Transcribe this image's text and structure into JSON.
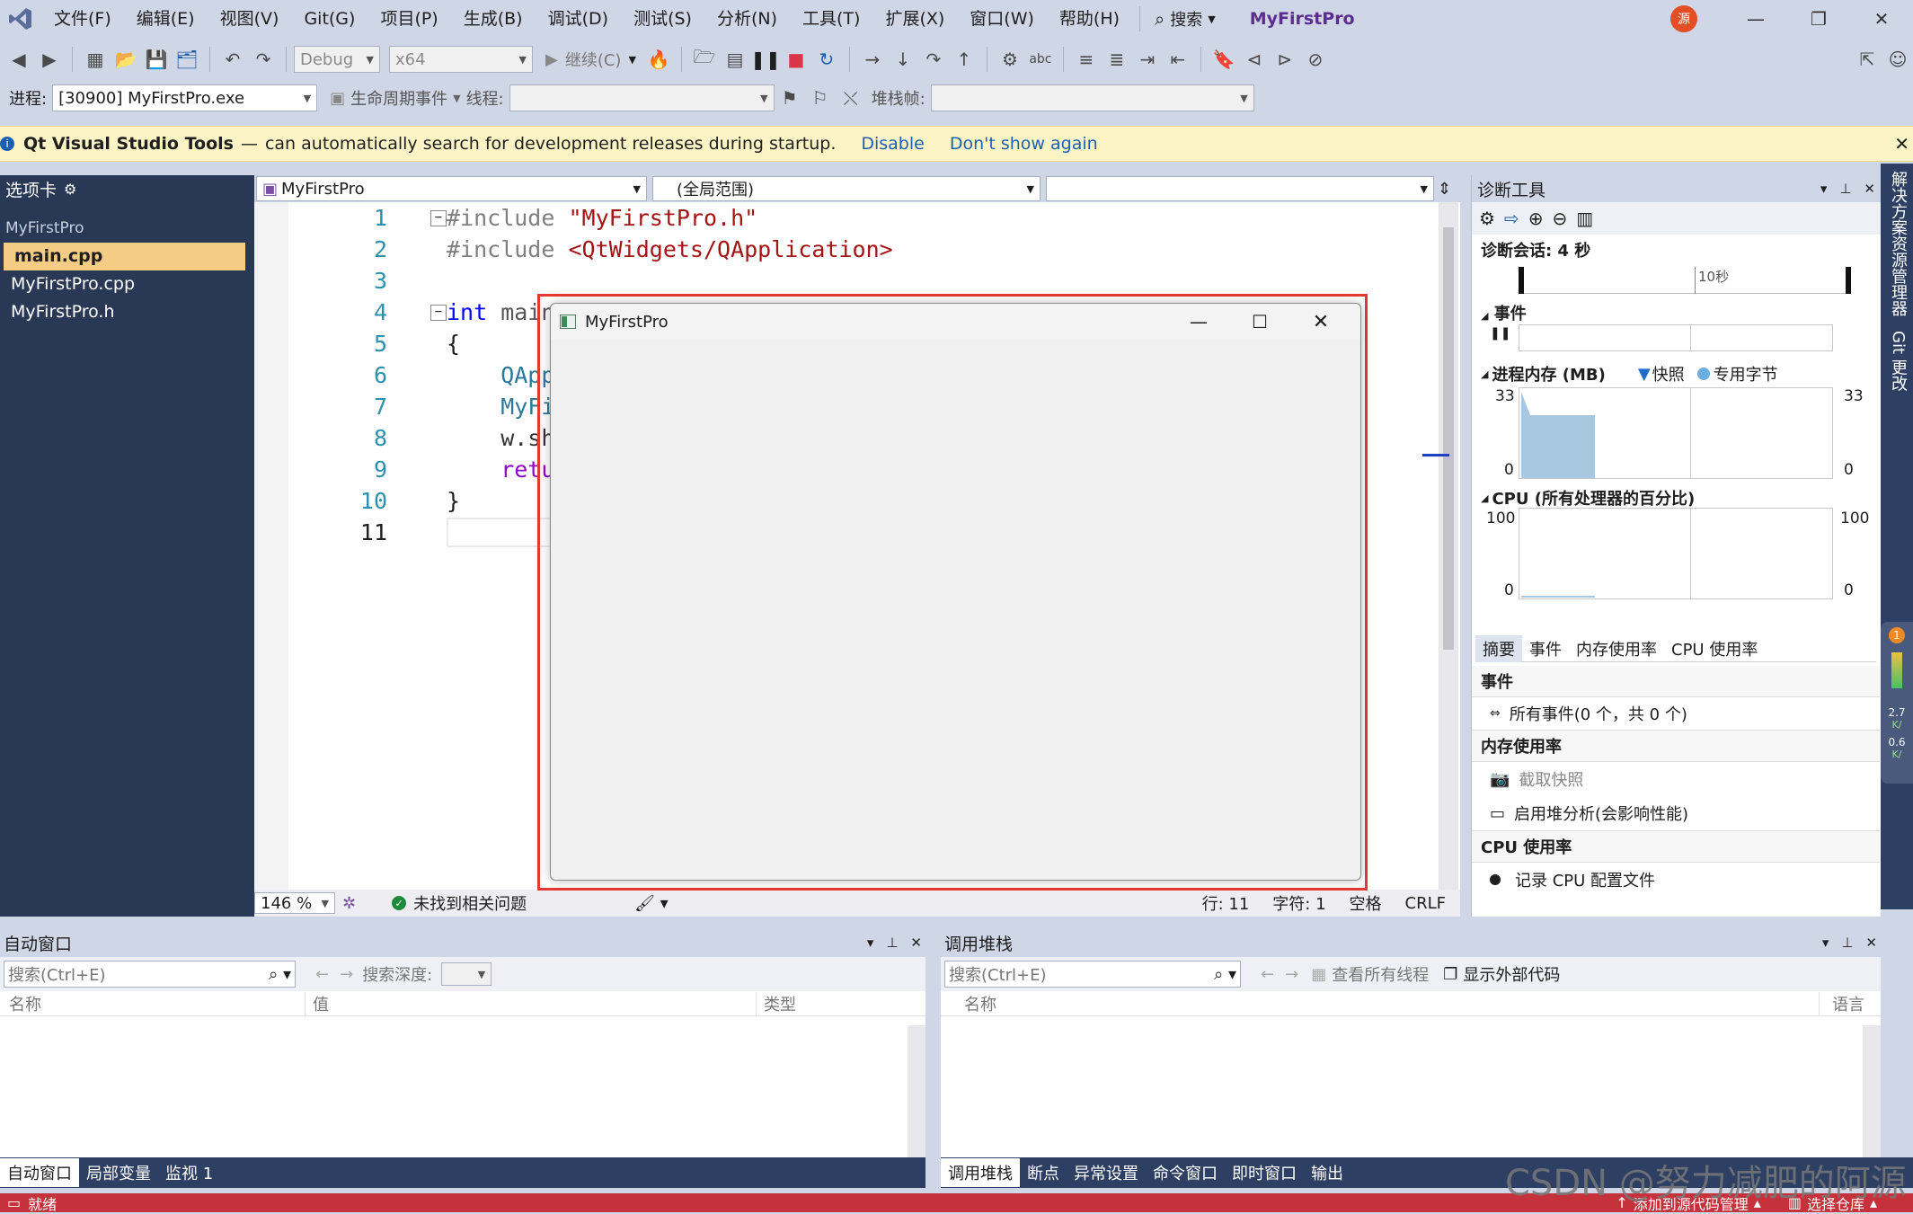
{
  "menu": {
    "items": [
      "文件(F)",
      "编辑(E)",
      "视图(V)",
      "Git(G)",
      "项目(P)",
      "生成(B)",
      "调试(D)",
      "测试(S)",
      "分析(N)",
      "工具(T)",
      "扩展(X)",
      "窗口(W)",
      "帮助(H)"
    ],
    "search_label": "搜索",
    "app_title": "MyFirstPro",
    "avatar_text": "源"
  },
  "toolbar": {
    "config": "Debug",
    "platform": "x64",
    "continue_label": "继续(C)"
  },
  "toolbar2": {
    "process_label": "进程:",
    "process_value": "[30900] MyFirstPro.exe",
    "lifecycle_label": "生命周期事件",
    "thread_label": "线程:",
    "stack_label": "堆栈帧:"
  },
  "infobar": {
    "product": "Qt Visual Studio Tools",
    "dash": "—",
    "message": "can automatically search for development releases during startup.",
    "disable": "Disable",
    "dont_show": "Don't show again"
  },
  "leftpanel": {
    "title": "选项卡",
    "project": "MyFirstPro",
    "files": [
      "main.cpp",
      "MyFirstPro.cpp",
      "MyFirstPro.h"
    ]
  },
  "editor": {
    "nav_project": "MyFirstPro",
    "nav_scope": "(全局范围)",
    "zoom": "146 %",
    "issues": "未找到相关问题",
    "line_info": "行: 11",
    "char_info": "字符: 1",
    "whitespace": "空格",
    "eol": "CRLF",
    "lines": [
      {
        "n": "1",
        "a": "#include ",
        "b": "\"MyFirstPro.h\""
      },
      {
        "n": "2",
        "a": "#include ",
        "b": "<QtWidgets/QApplication>"
      },
      {
        "n": "3",
        "a": "",
        "b": ""
      },
      {
        "n": "4",
        "a": "int",
        "b": " main(i"
      },
      {
        "n": "5",
        "a": "{",
        "b": ""
      },
      {
        "n": "6",
        "a": "    QAppli",
        "b": ""
      },
      {
        "n": "7",
        "a": "    MyFirs",
        "b": ""
      },
      {
        "n": "8",
        "a": "    w.show",
        "b": ""
      },
      {
        "n": "9",
        "a": "    return",
        "b": ""
      },
      {
        "n": "10",
        "a": "}",
        "b": ""
      },
      {
        "n": "11",
        "a": "",
        "b": ""
      }
    ]
  },
  "appwindow": {
    "title": "MyFirstPro"
  },
  "diag": {
    "title": "诊断工具",
    "session": "诊断会话: 4 秒",
    "timeline_label": "10秒",
    "events_h": "事件",
    "memory_h": "进程内存 (MB)",
    "snapshot_legend": "快照",
    "private_legend": "专用字节",
    "mem_max": "33",
    "mem_min": "0",
    "cpu_h": "CPU (所有处理器的百分比)",
    "cpu_max": "100",
    "cpu_min": "0",
    "tabs": [
      "摘要",
      "事件",
      "内存使用率",
      "CPU 使用率"
    ],
    "summary_events_h": "事件",
    "all_events": "所有事件(0 个，共 0 个)",
    "mem_usage_h": "内存使用率",
    "take_snapshot": "截取快照",
    "heap_profiling": "启用堆分析(会影响性能)",
    "cpu_usage_h": "CPU 使用率",
    "record_cpu": "记录 CPU 配置文件"
  },
  "vertical_tabs": [
    "解决方案资源管理器",
    "Git 更改"
  ],
  "side_meter": {
    "badge": "1",
    "up": "2.7",
    "up_unit": "K/",
    "down": "0.6",
    "down_unit": "K/"
  },
  "autos": {
    "title": "自动窗口",
    "search": "搜索(Ctrl+E)",
    "depth_label": "搜索深度:",
    "cols": [
      "名称",
      "值",
      "类型"
    ],
    "tabs": [
      "自动窗口",
      "局部变量",
      "监视 1"
    ]
  },
  "callstack": {
    "title": "调用堆栈",
    "search": "搜索(Ctrl+E)",
    "all_threads": "查看所有线程",
    "external_code": "显示外部代码",
    "cols": [
      "名称",
      "语言"
    ],
    "tabs": [
      "调用堆栈",
      "断点",
      "异常设置",
      "命令窗口",
      "即时窗口",
      "输出"
    ]
  },
  "status": {
    "ready": "就绪",
    "add_source": "添加到源代码管理",
    "select_repo": "选择仓库"
  },
  "watermark": "CSDN @努力减肥的阿源"
}
